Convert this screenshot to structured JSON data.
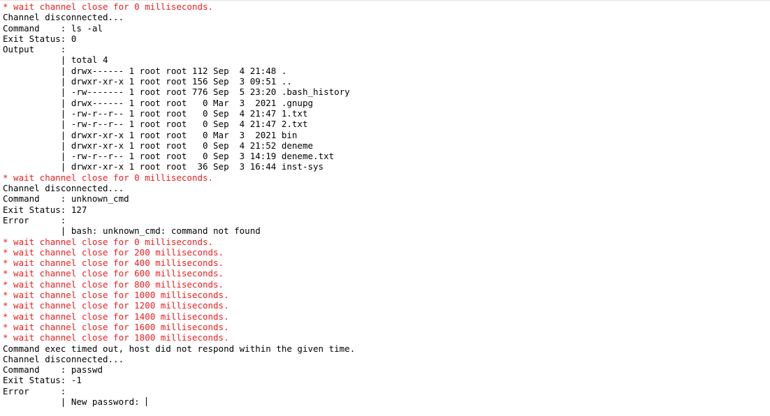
{
  "colors": {
    "background": "#ffffff",
    "text": "#000000",
    "debug_text": "#ee1c1c"
  },
  "console": {
    "lines": [
      {
        "text": "* wait channel close for 0 milliseconds.",
        "style": "red"
      },
      {
        "text": "Channel disconnected...",
        "style": "normal"
      },
      {
        "text": "Command    : ls -al",
        "style": "normal"
      },
      {
        "text": "Exit Status: 0",
        "style": "normal"
      },
      {
        "text": "Output     :",
        "style": "normal"
      },
      {
        "text": "           | total 4",
        "style": "normal"
      },
      {
        "text": "           | drwx------ 1 root root 112 Sep  4 21:48 .",
        "style": "normal"
      },
      {
        "text": "           | drwxr-xr-x 1 root root 156 Sep  3 09:51 ..",
        "style": "normal"
      },
      {
        "text": "           | -rw------- 1 root root 776 Sep  5 23:20 .bash_history",
        "style": "normal"
      },
      {
        "text": "           | drwx------ 1 root root   0 Mar  3  2021 .gnupg",
        "style": "normal"
      },
      {
        "text": "           | -rw-r--r-- 1 root root   0 Sep  4 21:47 1.txt",
        "style": "normal"
      },
      {
        "text": "           | -rw-r--r-- 1 root root   0 Sep  4 21:47 2.txt",
        "style": "normal"
      },
      {
        "text": "           | drwxr-xr-x 1 root root   0 Mar  3  2021 bin",
        "style": "normal"
      },
      {
        "text": "           | drwxr-xr-x 1 root root   0 Sep  4 21:52 deneme",
        "style": "normal"
      },
      {
        "text": "           | -rw-r--r-- 1 root root   0 Sep  3 14:19 deneme.txt",
        "style": "normal"
      },
      {
        "text": "           | drwxr-xr-x 1 root root  36 Sep  3 16:44 inst-sys",
        "style": "normal"
      },
      {
        "text": "* wait channel close for 0 milliseconds.",
        "style": "red"
      },
      {
        "text": "Channel disconnected...",
        "style": "normal"
      },
      {
        "text": "Command    : unknown_cmd",
        "style": "normal"
      },
      {
        "text": "Exit Status: 127",
        "style": "normal"
      },
      {
        "text": "Error      :",
        "style": "normal"
      },
      {
        "text": "           | bash: unknown_cmd: command not found",
        "style": "normal"
      },
      {
        "text": "* wait channel close for 0 milliseconds.",
        "style": "red"
      },
      {
        "text": "* wait channel close for 200 milliseconds.",
        "style": "red"
      },
      {
        "text": "* wait channel close for 400 milliseconds.",
        "style": "red"
      },
      {
        "text": "* wait channel close for 600 milliseconds.",
        "style": "red"
      },
      {
        "text": "* wait channel close for 800 milliseconds.",
        "style": "red"
      },
      {
        "text": "* wait channel close for 1000 milliseconds.",
        "style": "red"
      },
      {
        "text": "* wait channel close for 1200 milliseconds.",
        "style": "red"
      },
      {
        "text": "* wait channel close for 1400 milliseconds.",
        "style": "red"
      },
      {
        "text": "* wait channel close for 1600 milliseconds.",
        "style": "red"
      },
      {
        "text": "* wait channel close for 1800 milliseconds.",
        "style": "red"
      },
      {
        "text": "Command exec timed out, host did not respond within the given time.",
        "style": "normal"
      },
      {
        "text": "Channel disconnected...",
        "style": "normal"
      },
      {
        "text": "Command    : passwd",
        "style": "normal"
      },
      {
        "text": "Exit Status: -1",
        "style": "normal"
      },
      {
        "text": "Error      :",
        "style": "normal"
      },
      {
        "text": "           | New password: ",
        "style": "normal",
        "cursor": true
      }
    ]
  }
}
